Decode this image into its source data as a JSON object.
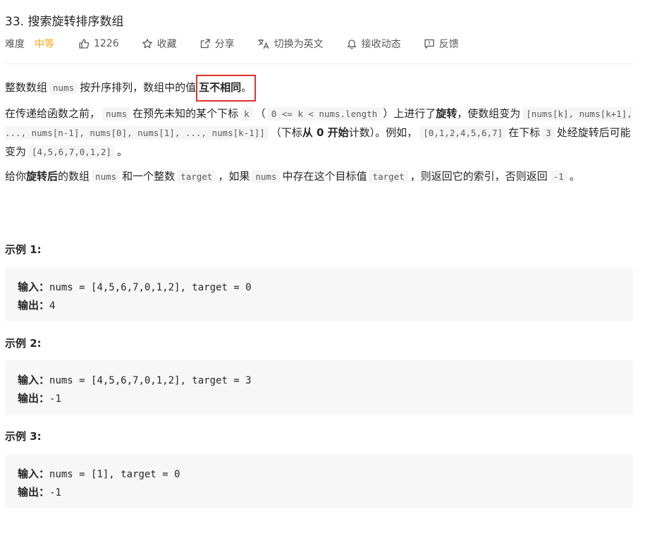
{
  "problem": {
    "title": "33. 搜索旋转排序数组",
    "difficulty_label": "难度",
    "difficulty_value": "中等",
    "likes": "1226",
    "favorite_label": "收藏",
    "share_label": "分享",
    "lang_switch_label": "切换为英文",
    "subscribe_label": "接收动态",
    "feedback_label": "反馈",
    "colors": {
      "difficulty": "#ffa116",
      "highlight_border": "#e0312c"
    }
  },
  "description": {
    "p1": {
      "t1": "整数数组",
      "c1": "nums",
      "t2": "按升序排列，数组中的值",
      "b1": "互不相同",
      "t3": "。"
    },
    "p2": {
      "t1": "在传递给函数之前，",
      "c1": "nums",
      "t2": "在预先未知的某个下标",
      "c2": "k",
      "t3": "（",
      "c3": "0 <= k < nums.length",
      "t4": "）上进行了",
      "b1": "旋转",
      "t5": "，使数组变为",
      "c4": "[nums[k], nums[k+1], ..., nums[n-1], nums[0], nums[1], ..., nums[k-1]]",
      "t6": "（下标",
      "b2": "从 0 开始",
      "t7": "计数）。例如，",
      "c5": "[0,1,2,4,5,6,7]",
      "t8": "在下标",
      "c6": "3",
      "t9": "处经旋转后可能变为",
      "c7": "[4,5,6,7,0,1,2]",
      "t10": "。"
    },
    "p3": {
      "t1": "给你",
      "b1": "旋转后",
      "t2": "的数组",
      "c1": "nums",
      "t3": "和一个整数",
      "c2": "target",
      "t4": "，如果",
      "c3": "nums",
      "t5": "中存在这个目标值",
      "c4": "target",
      "t6": "，则返回它的索引，否则返回",
      "c5": "-1",
      "t7": "。"
    }
  },
  "examples": [
    {
      "title": "示例 1:",
      "input_label": "输入：",
      "input": "nums = [4,5,6,7,0,1,2], target = 0",
      "output_label": "输出：",
      "output": "4"
    },
    {
      "title": "示例 2:",
      "input_label": "输入：",
      "input": "nums = [4,5,6,7,0,1,2], target = 3",
      "output_label": "输出：",
      "output": "-1"
    },
    {
      "title": "示例 3:",
      "input_label": "输入：",
      "input": "nums = [1], target = 0",
      "output_label": "输出：",
      "output": "-1"
    }
  ]
}
